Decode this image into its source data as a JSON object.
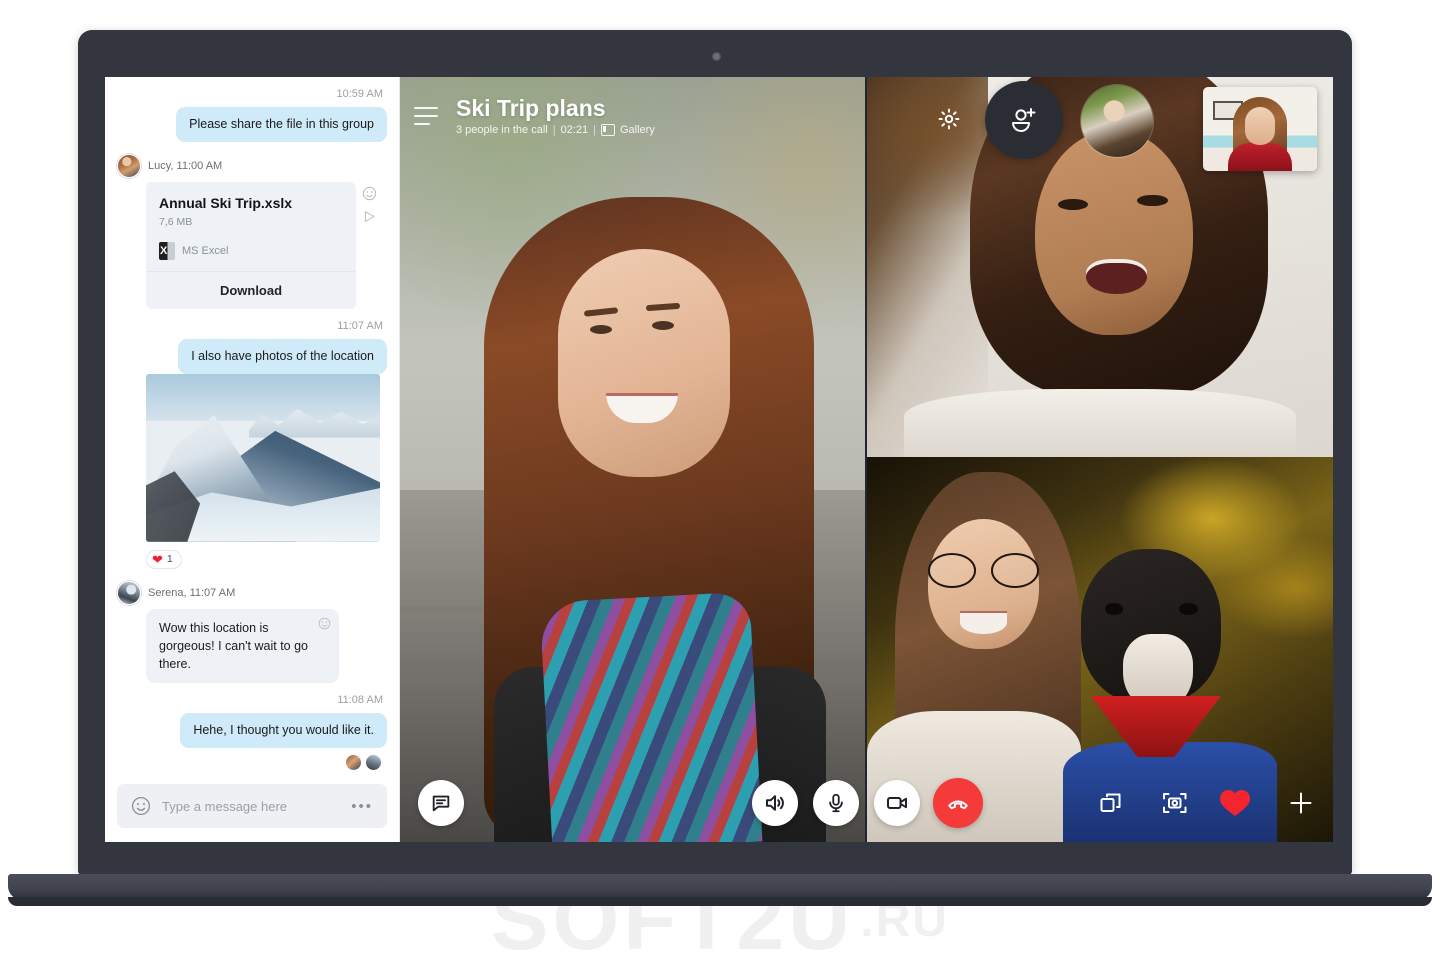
{
  "watermark": {
    "text": "SOFT2U",
    "suffix": ".RU"
  },
  "chat": {
    "messages": [
      {
        "type": "timestamp",
        "text": "10:59 AM"
      },
      {
        "type": "outgoing",
        "text": "Please share the file in this group"
      },
      {
        "type": "sender",
        "text": "Lucy, 11:00 AM"
      },
      {
        "type": "file",
        "name": "Annual Ski Trip.xslx",
        "size": "7,6 MB",
        "app": "MS Excel",
        "download_label": "Download"
      },
      {
        "type": "timestamp",
        "text": "11:07 AM"
      },
      {
        "type": "outgoing",
        "text": "I also have photos of the location"
      },
      {
        "type": "photo",
        "reaction_emoji": "heart-icon",
        "reaction_count": "1"
      },
      {
        "type": "sender",
        "text": "Serena, 11:07 AM"
      },
      {
        "type": "incoming",
        "text": "Wow this location is gorgeous! I can't wait to go there."
      },
      {
        "type": "timestamp",
        "text": "11:08 AM"
      },
      {
        "type": "outgoing",
        "text": "Hehe, I thought you would like it."
      }
    ],
    "m0_time": "10:59 AM",
    "m1_text": "Please share the file in this group",
    "m2_sender": "Lucy, 11:00 AM",
    "file": {
      "name": "Annual Ski Trip.xslx",
      "size": "7,6 MB",
      "app_label": "MS Excel",
      "app_icon": "excel-icon",
      "download_label": "Download",
      "react_icon": "smiley-icon",
      "forward_icon": "forward-icon"
    },
    "m3_time": "11:07 AM",
    "m4_text": "I also have photos of the location",
    "photo_alt": "snowy-mountain-photo",
    "reaction": {
      "icon": "heart-icon",
      "count": "1"
    },
    "m5_sender": "Serena, 11:07 AM",
    "m6_text": "Wow this location is gorgeous! I can't wait to go there.",
    "m7_time": "11:08 AM",
    "m8_text": "Hehe, I thought you would like it.",
    "composer": {
      "placeholder": "Type a message here",
      "emoji_icon": "smiley-icon",
      "more_icon": "more-dots-icon"
    }
  },
  "call": {
    "title": "Ski Trip plans",
    "participants": "3 people in the call",
    "separator": "|",
    "duration": "02:21",
    "layout_icon": "gallery-icon",
    "layout_label": "Gallery",
    "menu_icon": "hamburger-icon",
    "top_controls": {
      "settings_icon": "gear-icon",
      "add_person_icon": "add-person-icon",
      "avatar_name": "participant-avatar",
      "self_view_name": "self-view-pip"
    },
    "controls": [
      {
        "name": "chat-button",
        "icon": "chat-bubble-icon",
        "style": "light"
      },
      {
        "name": "speaker-button",
        "icon": "speaker-icon",
        "style": "light"
      },
      {
        "name": "mic-button",
        "icon": "microphone-icon",
        "style": "light"
      },
      {
        "name": "video-button",
        "icon": "video-camera-icon",
        "style": "light"
      },
      {
        "name": "end-call-button",
        "icon": "end-call-icon",
        "style": "red"
      },
      {
        "name": "screen-share-button",
        "icon": "screen-share-icon",
        "style": "plain"
      },
      {
        "name": "snapshot-button",
        "icon": "snapshot-icon",
        "style": "plain"
      },
      {
        "name": "heart-reaction-button",
        "icon": "heart-icon",
        "style": "plain"
      },
      {
        "name": "add-button",
        "icon": "plus-icon",
        "style": "plain"
      }
    ]
  },
  "colors": {
    "outgoing_bubble": "#cfeaf8",
    "incoming_bubble": "#eef2f7",
    "end_call_red": "#f53a3a",
    "heart_red": "#e8233a",
    "laptop_body": "#33353f",
    "dark_circle": "#2b2d35"
  }
}
